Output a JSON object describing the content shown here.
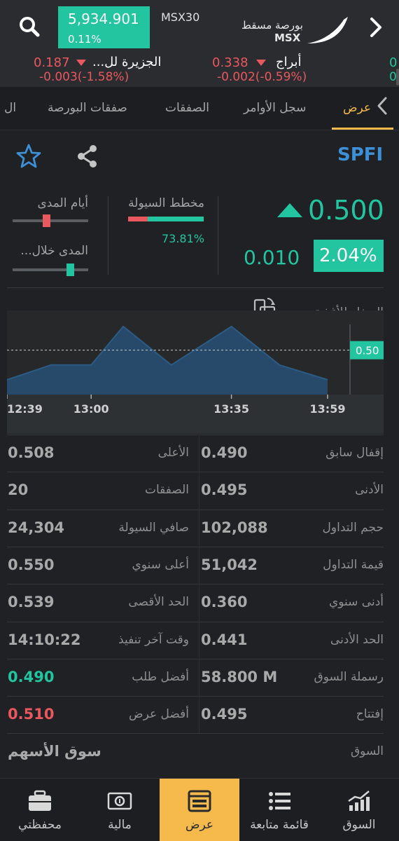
{
  "header": {
    "index_value": "5,934.901",
    "index_change": "0.11%",
    "index_name": "MSX30",
    "exchange_name_ar": "بورصة مسقط",
    "exchange_code": "MSX"
  },
  "ticker": [
    {
      "name": "الجزيرة لل...",
      "price": "0.187",
      "change": "-0.003(-1.58%)"
    },
    {
      "name": "أبراج",
      "price": "0.338",
      "change": "-0.002(-0.59%)"
    },
    {
      "name": "",
      "price": "0",
      "change": "0"
    }
  ],
  "tabs": [
    {
      "label": "عرض"
    },
    {
      "label": "سجل الأوامر"
    },
    {
      "label": "الصفقات"
    },
    {
      "label": "صفقات البورصة"
    },
    {
      "label": "ال"
    }
  ],
  "quote": {
    "symbol": "SPFI",
    "price": "0.500",
    "change_value": "0.010",
    "change_percent": "2.04%",
    "liquidity_label": "مخطط السيولة",
    "liquidity_value": "73.81%",
    "liquidity_fraction": 0.7381,
    "range_days_label": "أيام المدى",
    "range_days_position": 0.44,
    "range_period_label": "المدى خلال...",
    "range_period_position": 0.76,
    "company_name": "الصفاء للأغذية"
  },
  "chart_data": {
    "type": "area",
    "x": [
      "12:39",
      "12:50",
      "13:00",
      "13:08",
      "13:20",
      "13:35",
      "13:47",
      "13:59"
    ],
    "values": [
      0.49,
      0.495,
      0.495,
      0.508,
      0.495,
      0.508,
      0.495,
      0.49
    ],
    "ylim": [
      0.485,
      0.512
    ],
    "reference_value": 0.5,
    "reference_label": "0.50",
    "x_tick_labels": [
      "12:39",
      "13:00",
      "13:35",
      "13:59"
    ],
    "series_color": "#2c5b84",
    "fill_color": "#27496a"
  },
  "stats": [
    {
      "right_label": "إقفال سابق",
      "right_value": "0.490",
      "left_label": "الأعلى",
      "left_value": "0.508",
      "left_color": ""
    },
    {
      "right_label": "الأدنى",
      "right_value": "0.495",
      "left_label": "الصفقات",
      "left_value": "20",
      "left_color": ""
    },
    {
      "right_label": "حجم التداول",
      "right_value": "102,088",
      "left_label": "صافي السيولة",
      "left_value": "24,304",
      "left_color": ""
    },
    {
      "right_label": "قيمة التداول",
      "right_value": "51,042",
      "left_label": "أعلى سنوي",
      "left_value": "0.550",
      "left_color": ""
    },
    {
      "right_label": "أدنى سنوي",
      "right_value": "0.360",
      "left_label": "الحد الأقصى",
      "left_value": "0.539",
      "left_color": ""
    },
    {
      "right_label": "الحد الأدنى",
      "right_value": "0.441",
      "left_label": "وقت آخر تنفيذ",
      "left_value": "14:10:22",
      "left_color": ""
    },
    {
      "right_label": "رسملة السوق",
      "right_value": "58.800 M",
      "left_label": "أفضل طلب",
      "left_value": "0.490",
      "left_color": "#22c5a0"
    },
    {
      "right_label": "إفتتاح",
      "right_value": "0.495",
      "left_label": "أفضل عرض",
      "left_value": "0.510",
      "left_color": "#e8585e"
    },
    {
      "right_label": "السوق",
      "right_value": "",
      "left_label": "",
      "left_value": "سوق الأسهم",
      "left_color": ""
    }
  ],
  "bottom_nav": [
    {
      "label": "محفظتي",
      "icon": "briefcase-icon"
    },
    {
      "label": "مالية",
      "icon": "money-icon"
    },
    {
      "label": "عرض",
      "icon": "display-icon",
      "active": true
    },
    {
      "label": "قائمة متابعة",
      "icon": "list-icon"
    },
    {
      "label": "السوق",
      "icon": "market-chart-icon"
    }
  ],
  "colors": {
    "accent_green": "#22c5a0",
    "down_red": "#e8585e",
    "active_tab": "#f5b94c",
    "symbol_blue": "#3d8fd6"
  }
}
